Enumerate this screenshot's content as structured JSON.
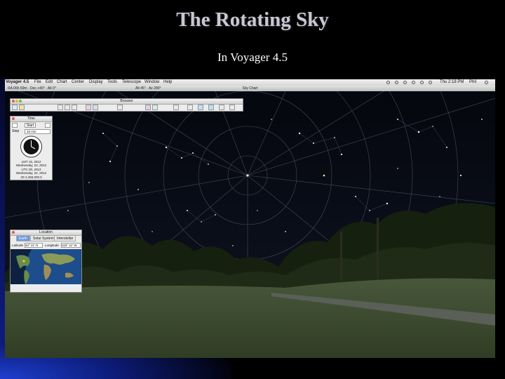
{
  "slide": {
    "title": "The Rotating Sky",
    "subtitle": "In Voyager 4.5"
  },
  "menubar": {
    "app_name": "Voyager 4.5",
    "items": [
      "File",
      "Edit",
      "Chart",
      "Center",
      "Display",
      "Tools",
      "Telescope",
      "Window",
      "Help"
    ],
    "clock": "Thu 2:18 PM",
    "user": "Phil"
  },
  "sky_chart": {
    "window_title": "Sky Chart",
    "readout_left": "RA 06h 50m · Dec +40° · Alt 0°",
    "readout_right": "Alt 45° · Az 280°"
  },
  "browser_panel": {
    "title": "Browser"
  },
  "time_panel": {
    "title": "Time",
    "start_label": "Start",
    "step_label": "Step",
    "step_value": "15 min",
    "local_time_1": "LMT 15, 2012",
    "local_date": "Wednesday, 22, 2012",
    "ut_time": "UTC 00, 2012",
    "ut_date": "Wednesday, 22, 2012",
    "jd": "JD 2,456,000.5"
  },
  "location_panel": {
    "title": "Location",
    "tabs": [
      "Earth",
      "Solar System",
      "Interstellar"
    ],
    "latitude_label": "Latitude",
    "latitude_value": "34° 21' N",
    "longitude_label": "Longitude",
    "longitude_value": "118° 41' W"
  },
  "colors": {
    "accent_blue": "#1e3fd0",
    "menubar": "#e6e6e6",
    "grass": "#3a4a2c",
    "sky": "#0a0d18"
  }
}
